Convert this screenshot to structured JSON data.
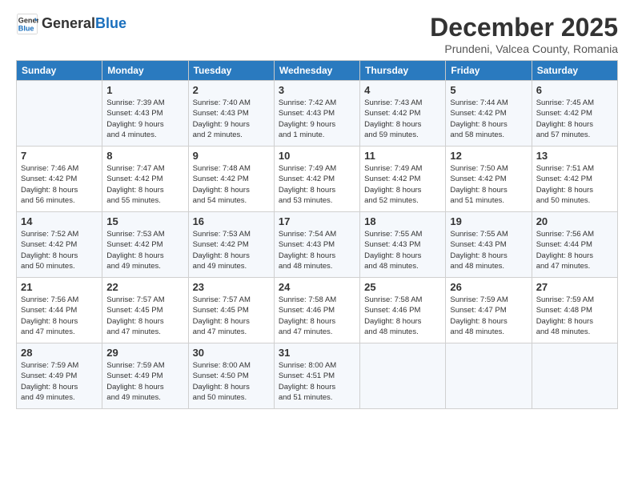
{
  "header": {
    "logo_line1": "General",
    "logo_line2": "Blue",
    "month_title": "December 2025",
    "subtitle": "Prundeni, Valcea County, Romania"
  },
  "days_of_week": [
    "Sunday",
    "Monday",
    "Tuesday",
    "Wednesday",
    "Thursday",
    "Friday",
    "Saturday"
  ],
  "weeks": [
    [
      {
        "day": "",
        "info": ""
      },
      {
        "day": "1",
        "info": "Sunrise: 7:39 AM\nSunset: 4:43 PM\nDaylight: 9 hours\nand 4 minutes."
      },
      {
        "day": "2",
        "info": "Sunrise: 7:40 AM\nSunset: 4:43 PM\nDaylight: 9 hours\nand 2 minutes."
      },
      {
        "day": "3",
        "info": "Sunrise: 7:42 AM\nSunset: 4:43 PM\nDaylight: 9 hours\nand 1 minute."
      },
      {
        "day": "4",
        "info": "Sunrise: 7:43 AM\nSunset: 4:42 PM\nDaylight: 8 hours\nand 59 minutes."
      },
      {
        "day": "5",
        "info": "Sunrise: 7:44 AM\nSunset: 4:42 PM\nDaylight: 8 hours\nand 58 minutes."
      },
      {
        "day": "6",
        "info": "Sunrise: 7:45 AM\nSunset: 4:42 PM\nDaylight: 8 hours\nand 57 minutes."
      }
    ],
    [
      {
        "day": "7",
        "info": "Sunrise: 7:46 AM\nSunset: 4:42 PM\nDaylight: 8 hours\nand 56 minutes."
      },
      {
        "day": "8",
        "info": "Sunrise: 7:47 AM\nSunset: 4:42 PM\nDaylight: 8 hours\nand 55 minutes."
      },
      {
        "day": "9",
        "info": "Sunrise: 7:48 AM\nSunset: 4:42 PM\nDaylight: 8 hours\nand 54 minutes."
      },
      {
        "day": "10",
        "info": "Sunrise: 7:49 AM\nSunset: 4:42 PM\nDaylight: 8 hours\nand 53 minutes."
      },
      {
        "day": "11",
        "info": "Sunrise: 7:49 AM\nSunset: 4:42 PM\nDaylight: 8 hours\nand 52 minutes."
      },
      {
        "day": "12",
        "info": "Sunrise: 7:50 AM\nSunset: 4:42 PM\nDaylight: 8 hours\nand 51 minutes."
      },
      {
        "day": "13",
        "info": "Sunrise: 7:51 AM\nSunset: 4:42 PM\nDaylight: 8 hours\nand 50 minutes."
      }
    ],
    [
      {
        "day": "14",
        "info": "Sunrise: 7:52 AM\nSunset: 4:42 PM\nDaylight: 8 hours\nand 50 minutes."
      },
      {
        "day": "15",
        "info": "Sunrise: 7:53 AM\nSunset: 4:42 PM\nDaylight: 8 hours\nand 49 minutes."
      },
      {
        "day": "16",
        "info": "Sunrise: 7:53 AM\nSunset: 4:42 PM\nDaylight: 8 hours\nand 49 minutes."
      },
      {
        "day": "17",
        "info": "Sunrise: 7:54 AM\nSunset: 4:43 PM\nDaylight: 8 hours\nand 48 minutes."
      },
      {
        "day": "18",
        "info": "Sunrise: 7:55 AM\nSunset: 4:43 PM\nDaylight: 8 hours\nand 48 minutes."
      },
      {
        "day": "19",
        "info": "Sunrise: 7:55 AM\nSunset: 4:43 PM\nDaylight: 8 hours\nand 48 minutes."
      },
      {
        "day": "20",
        "info": "Sunrise: 7:56 AM\nSunset: 4:44 PM\nDaylight: 8 hours\nand 47 minutes."
      }
    ],
    [
      {
        "day": "21",
        "info": "Sunrise: 7:56 AM\nSunset: 4:44 PM\nDaylight: 8 hours\nand 47 minutes."
      },
      {
        "day": "22",
        "info": "Sunrise: 7:57 AM\nSunset: 4:45 PM\nDaylight: 8 hours\nand 47 minutes."
      },
      {
        "day": "23",
        "info": "Sunrise: 7:57 AM\nSunset: 4:45 PM\nDaylight: 8 hours\nand 47 minutes."
      },
      {
        "day": "24",
        "info": "Sunrise: 7:58 AM\nSunset: 4:46 PM\nDaylight: 8 hours\nand 47 minutes."
      },
      {
        "day": "25",
        "info": "Sunrise: 7:58 AM\nSunset: 4:46 PM\nDaylight: 8 hours\nand 48 minutes."
      },
      {
        "day": "26",
        "info": "Sunrise: 7:59 AM\nSunset: 4:47 PM\nDaylight: 8 hours\nand 48 minutes."
      },
      {
        "day": "27",
        "info": "Sunrise: 7:59 AM\nSunset: 4:48 PM\nDaylight: 8 hours\nand 48 minutes."
      }
    ],
    [
      {
        "day": "28",
        "info": "Sunrise: 7:59 AM\nSunset: 4:49 PM\nDaylight: 8 hours\nand 49 minutes."
      },
      {
        "day": "29",
        "info": "Sunrise: 7:59 AM\nSunset: 4:49 PM\nDaylight: 8 hours\nand 49 minutes."
      },
      {
        "day": "30",
        "info": "Sunrise: 8:00 AM\nSunset: 4:50 PM\nDaylight: 8 hours\nand 50 minutes."
      },
      {
        "day": "31",
        "info": "Sunrise: 8:00 AM\nSunset: 4:51 PM\nDaylight: 8 hours\nand 51 minutes."
      },
      {
        "day": "",
        "info": ""
      },
      {
        "day": "",
        "info": ""
      },
      {
        "day": "",
        "info": ""
      }
    ]
  ]
}
